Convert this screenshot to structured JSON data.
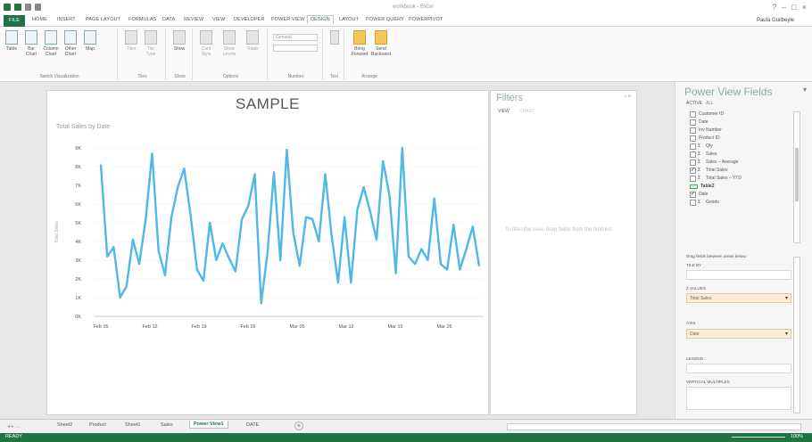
{
  "titlebar": {
    "window_title": "workbook - Excel",
    "controls": [
      "?",
      "–",
      "□",
      "×"
    ]
  },
  "ribbon_tabs": [
    "FILE",
    "HOME",
    "INSERT",
    "PAGE LAYOUT",
    "FORMULAS",
    "DATA",
    "REVIEW",
    "VIEW",
    "DEVELOPER",
    "POWER VIEW",
    "DESIGN",
    "LAYOUT",
    "POWER QUERY",
    "POWERPIVOT"
  ],
  "active_tab": "DESIGN",
  "user": "Paula Guilbeyle",
  "ribbon": {
    "buttons": [
      {
        "label": "Table",
        "group": 0
      },
      {
        "label": "Bar Chart",
        "group": 0
      },
      {
        "label": "Column Chart",
        "group": 0
      },
      {
        "label": "Other Chart",
        "group": 0
      },
      {
        "label": "Map",
        "group": 0
      },
      {
        "label": "Tiles",
        "group": 1
      },
      {
        "label": "Tile Type",
        "group": 1
      },
      {
        "label": "Show",
        "group": 2
      },
      {
        "label": "Card Style",
        "group": 3
      },
      {
        "label": "Show Levels",
        "group": 3
      },
      {
        "label": "Totals",
        "group": 3
      },
      {
        "label": "Bring Forward",
        "group": 5
      },
      {
        "label": "Send Backward",
        "group": 5
      }
    ],
    "groups": [
      "Switch Visualization",
      "Tiles",
      "Show",
      "Options",
      "Number",
      "Text",
      "Arrange"
    ],
    "number_format_placeholder": "General"
  },
  "canvas": {
    "title": "SAMPLE",
    "chart_label": "Total Sales by Date"
  },
  "chart_data": {
    "type": "line",
    "title": "Total Sales by Date",
    "xlabel": "",
    "ylabel": "Total Sales",
    "ylim": [
      0,
      9000
    ],
    "yticks": [
      "0K",
      "1K",
      "2K",
      "3K",
      "4K",
      "5K",
      "6K",
      "7K",
      "8K",
      "9K"
    ],
    "xticks": [
      "Feb 05",
      "Feb 12",
      "Feb 19",
      "Feb 26",
      "Mar 05",
      "Mar 12",
      "Mar 19",
      "Mar 26"
    ],
    "color": "#4fb8e6",
    "series": [
      {
        "values": [
          8100,
          3200,
          3700,
          1000,
          1600,
          4100,
          2800,
          5200,
          8700,
          3500,
          2200,
          5300,
          6900,
          7900,
          5400,
          2500,
          1900,
          5000,
          3000,
          3900,
          3100,
          2400,
          5200,
          5900,
          7600,
          700,
          3400,
          7700,
          3000,
          8900,
          4500,
          2700,
          5300,
          5200,
          4000,
          7600,
          4300,
          1800,
          5300,
          1800,
          5700,
          6900,
          5600,
          4100,
          8300,
          6500,
          2300,
          9000,
          3200,
          2800,
          3600,
          3000,
          6300,
          2800,
          2500,
          4900,
          2500,
          3600,
          4800,
          2700
        ]
      }
    ]
  },
  "filters": {
    "title": "Filters",
    "tabs": [
      "VIEW",
      "CHART"
    ],
    "message": "To filter the view, drag fields from the field list.",
    "controls": "‹ ×"
  },
  "fields": {
    "title": "Power View Fields",
    "tabs": [
      "ACTIVE",
      "ALL"
    ],
    "items": [
      {
        "label": "Customer ID",
        "checked": false,
        "sigma": false
      },
      {
        "label": "Date",
        "checked": false,
        "sigma": false
      },
      {
        "label": "Inv Number",
        "checked": false,
        "sigma": false
      },
      {
        "label": "Product ID",
        "checked": false,
        "sigma": false
      },
      {
        "label": "Qty",
        "checked": false,
        "sigma": true
      },
      {
        "label": "Sales",
        "checked": false,
        "sigma": true
      },
      {
        "label": "Sales – Average",
        "checked": false,
        "sigma": true
      },
      {
        "label": "Total Sales",
        "checked": true,
        "sigma": true
      },
      {
        "label": "Total Sales – YTD",
        "checked": false,
        "sigma": true
      },
      {
        "label": "Table2",
        "table": true
      },
      {
        "label": "Date",
        "checked": true,
        "sigma": false
      },
      {
        "label": "Goods",
        "checked": false,
        "sigma": true
      }
    ],
    "drop_info": "Drag fields between areas below:",
    "zones": [
      {
        "label": "TILE BY",
        "value": ""
      },
      {
        "label": "Σ VALUES",
        "value": "Total Sales"
      },
      {
        "label": "AXIS",
        "value": "Date"
      },
      {
        "label": "LEGEND",
        "value": ""
      },
      {
        "label": "VERTICAL MULTIPLES",
        "value": ""
      }
    ]
  },
  "sheet_tabs": [
    "Sheet2",
    "Product",
    "Sheet1",
    "Sales",
    "Power View1",
    "DATE"
  ],
  "active_sheet": "Power View1",
  "status": {
    "text": "READY",
    "zoom": "100%"
  }
}
